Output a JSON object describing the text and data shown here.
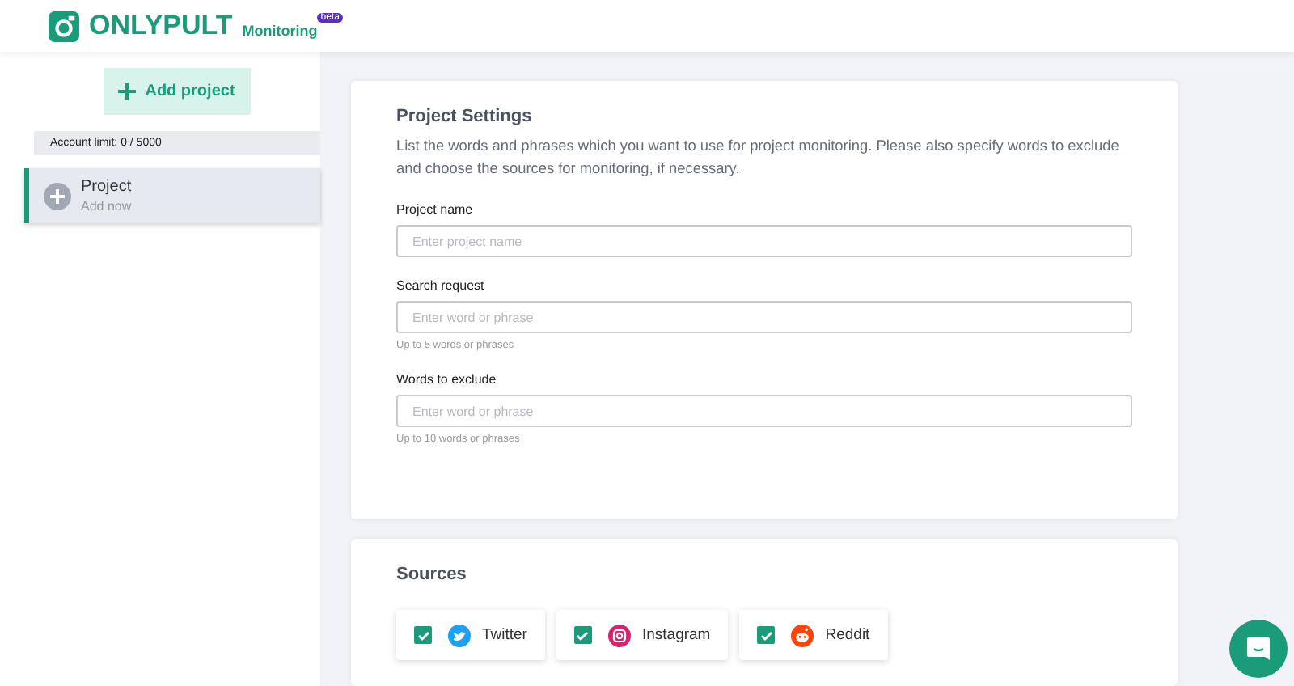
{
  "header": {
    "brand": "ONLYPULT",
    "product": "Monitoring",
    "badge": "beta"
  },
  "sidebar": {
    "add_button": "Add project",
    "account_limit": "Account limit: 0 / 5000",
    "projects": [
      {
        "title": "Project",
        "subtitle": "Add now",
        "selected": true
      }
    ]
  },
  "settings": {
    "title": "Project Settings",
    "description": "List the words and phrases which you want to use for project monitoring. Please also specify words to exclude and choose the sources for monitoring, if necessary.",
    "fields": [
      {
        "label": "Project name",
        "placeholder": "Enter project name"
      },
      {
        "label": "Search request",
        "placeholder": "Enter word or phrase",
        "hint": "Up to 5 words or phrases"
      },
      {
        "label": "Words to exclude",
        "placeholder": "Enter word or phrase",
        "hint": "Up to 10 words or phrases"
      }
    ]
  },
  "sources": {
    "title": "Sources",
    "items": [
      {
        "label": "Twitter",
        "kind": "twitter",
        "checked": true
      },
      {
        "label": "Instagram",
        "kind": "instagram",
        "checked": true
      },
      {
        "label": "Reddit",
        "kind": "reddit",
        "checked": true
      }
    ]
  }
}
